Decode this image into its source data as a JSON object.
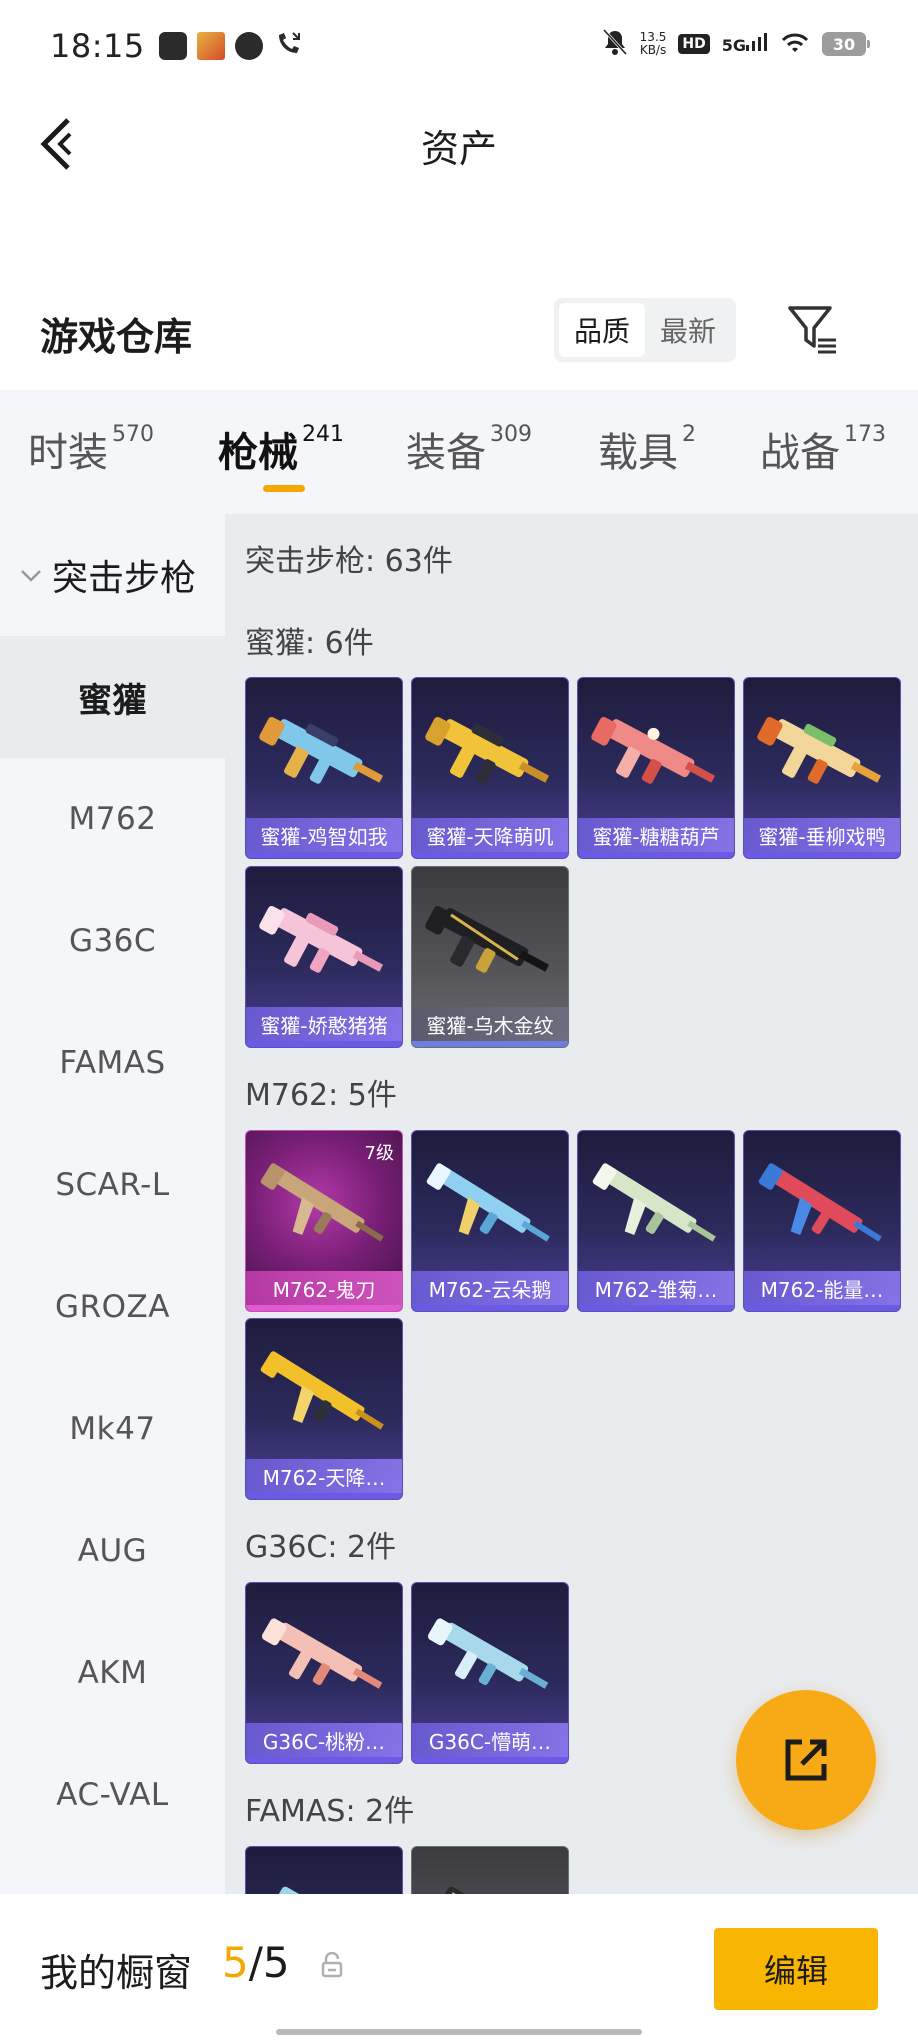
{
  "status_bar": {
    "time": "18:15",
    "net_speed_value": "13.5",
    "net_speed_unit": "KB/s",
    "hd": "HD",
    "signal": "5G",
    "battery": "30"
  },
  "header": {
    "title": "资产"
  },
  "warehouse": {
    "title": "游戏仓库",
    "sort_options": [
      "品质",
      "最新"
    ],
    "selected_sort": "品质"
  },
  "tabs": [
    {
      "label": "时装",
      "count": "570"
    },
    {
      "label": "枪械",
      "count": "241",
      "active": true
    },
    {
      "label": "装备",
      "count": "309"
    },
    {
      "label": "载具",
      "count": "2"
    },
    {
      "label": "战备",
      "count": "173"
    }
  ],
  "sidebar": {
    "category": "突击步枪",
    "items": [
      "蜜獾",
      "M762",
      "G36C",
      "FAMAS",
      "SCAR-L",
      "GROZA",
      "Mk47",
      "AUG",
      "AKM",
      "AC-VAL"
    ],
    "active_index": 0
  },
  "content": {
    "summary": "突击步枪: 63件",
    "sections": [
      {
        "title": "蜜獾: 6件",
        "items": [
          {
            "name": "蜜獾-鸡智如我"
          },
          {
            "name": "蜜獾-天降萌叽"
          },
          {
            "name": "蜜獾-糖糖葫芦"
          },
          {
            "name": "蜜獾-垂柳戏鸭"
          },
          {
            "name": "蜜獾-娇憨猪猪"
          },
          {
            "name": "蜜獾-乌木金纹"
          }
        ]
      },
      {
        "title": "M762: 5件",
        "items": [
          {
            "name": "M762-鬼刀",
            "level": "7级"
          },
          {
            "name": "M762-云朵鹅"
          },
          {
            "name": "M762-雏菊…"
          },
          {
            "name": "M762-能量…"
          },
          {
            "name": "M762-天降…"
          }
        ]
      },
      {
        "title": "G36C: 2件",
        "items": [
          {
            "name": "G36C-桃粉…"
          },
          {
            "name": "G36C-懵萌…"
          }
        ]
      },
      {
        "title": "FAMAS: 2件",
        "items": []
      }
    ]
  },
  "showcase": {
    "label": "我的橱窗",
    "current": "5",
    "separator": "/",
    "total": "5",
    "edit_label": "编辑"
  },
  "colors": {
    "accent": "#f8b502",
    "rare_purple": "#5b4fb3",
    "legend_pink": "#c04fb8"
  }
}
